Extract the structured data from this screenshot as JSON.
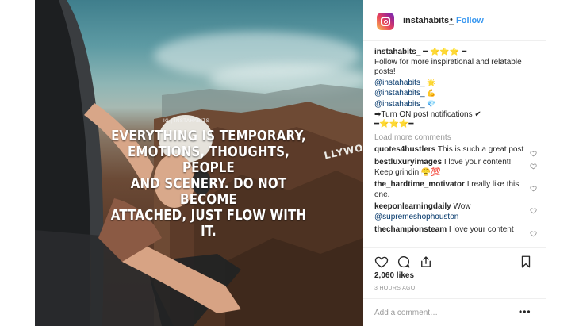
{
  "post": {
    "image_quote": [
      "EVERYTHING IS TEMPORARY,",
      "EMOTIONS, THOUGHTS, PEOPLE",
      "AND SCENERY. DO NOT BECOME",
      "ATTACHED, JUST FLOW WITH IT."
    ],
    "image_watermark": "IG | INSTAHABITS",
    "image_sign": "LLYWOOD"
  },
  "header": {
    "username": "instahabits_",
    "separator": "•",
    "follow_label": "Follow"
  },
  "caption": {
    "username": "instahabits_",
    "line1": "━ ⭐⭐⭐ ━",
    "line2": "Follow for more inspirational and relatable posts!",
    "mention1": "@instahabits_",
    "mention1_emoji": "🌟",
    "mention2": "@instahabits_",
    "mention2_emoji": "💪",
    "mention3": "@instahabits_",
    "mention3_emoji": "💎",
    "line_notify": "➡Turn ON post notifications ✔",
    "line_stars": "━⭐⭐⭐━"
  },
  "load_more_label": "Load more comments",
  "comments": [
    {
      "user": "quotes4hustlers",
      "text": "This is such a great post"
    },
    {
      "user": "bestluxuryimages",
      "text": "I love your content! Keep grindin 😤💯"
    },
    {
      "user": "the_hardtime_motivator",
      "text": "I really like this one."
    },
    {
      "user": "keeponlearningdaily",
      "text": "Wow",
      "mention": "@supremeshophouston"
    },
    {
      "user": "thechampionsteam",
      "text": "I love your content"
    }
  ],
  "icons": {
    "like": "heart-icon",
    "comment": "comment-icon",
    "share": "share-icon",
    "save": "bookmark-icon",
    "more": "more-options-icon"
  },
  "likes_label": "2,060 likes",
  "timestamp": "3 HOURS AGO",
  "add_comment_placeholder": "Add a comment…",
  "more_label": "•••"
}
